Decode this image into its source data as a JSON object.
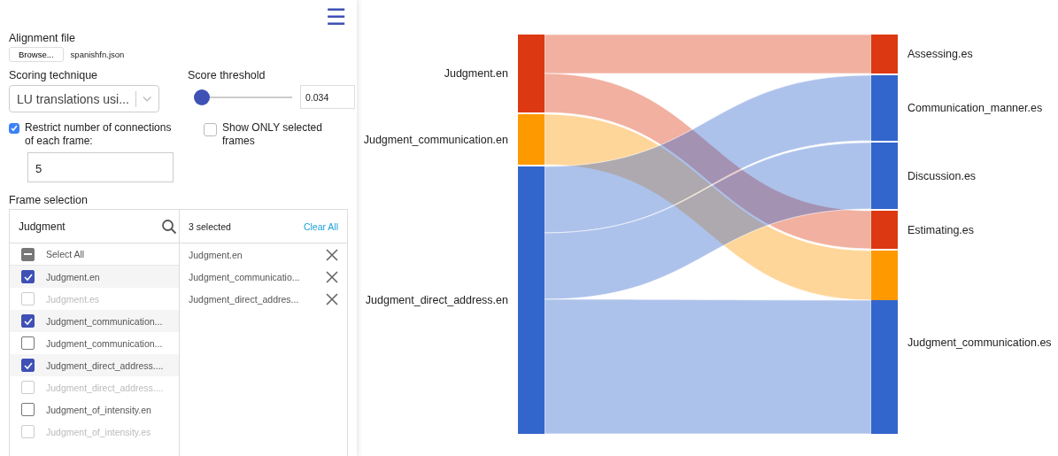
{
  "menu_button": {
    "icon": "☰"
  },
  "alignment_file": {
    "label": "Alignment file",
    "button": "Browse...",
    "file_name": "spanishfn.json"
  },
  "scoring_technique": {
    "label": "Scoring technique",
    "value": "LU translations usi..."
  },
  "score_threshold": {
    "label": "Score threshold",
    "level": 0.07,
    "value": "0.034"
  },
  "restrict_connections": {
    "label": "Restrict number of connections of each frame:",
    "checked": true,
    "value": "5"
  },
  "show_only_selected": {
    "label": "Show ONLY selected frames",
    "checked": false
  },
  "frame_selection": {
    "label": "Frame selection",
    "search": "Judgment",
    "selected_count": "3 selected",
    "clear_all": "Clear All",
    "select_all": {
      "label": "Select All",
      "partial": true
    },
    "items": [
      {
        "label": "Judgment.en",
        "checked": true,
        "disabled": false
      },
      {
        "label": "Judgment.es",
        "checked": false,
        "disabled": true
      },
      {
        "label": "Judgment_communication...",
        "checked": true,
        "disabled": false
      },
      {
        "label": "Judgment_communication...",
        "checked": false,
        "disabled": false
      },
      {
        "label": "Judgment_direct_address....",
        "checked": true,
        "disabled": false
      },
      {
        "label": "Judgment_direct_address....",
        "checked": false,
        "disabled": true
      },
      {
        "label": "Judgment_of_intensity.en",
        "checked": false,
        "disabled": false
      },
      {
        "label": "Judgment_of_intensity.es",
        "checked": false,
        "disabled": true
      }
    ],
    "selected": [
      "Judgment.en",
      "Judgment_communicatio...",
      "Judgment_direct_addres..."
    ]
  },
  "sankey": {
    "sources": [
      {
        "label": "Judgment.en",
        "color": "#dc3912"
      },
      {
        "label": "Judgment_communication.en",
        "color": "#ff9900"
      },
      {
        "label": "Judgment_direct_address.en",
        "color": "#3366cc"
      }
    ],
    "targets": [
      {
        "label": "Assessing.es"
      },
      {
        "label": "Communication_manner.es"
      },
      {
        "label": "Discussion.es"
      },
      {
        "label": "Estimating.es"
      },
      {
        "label": "Judgment_communication.es"
      }
    ]
  }
}
